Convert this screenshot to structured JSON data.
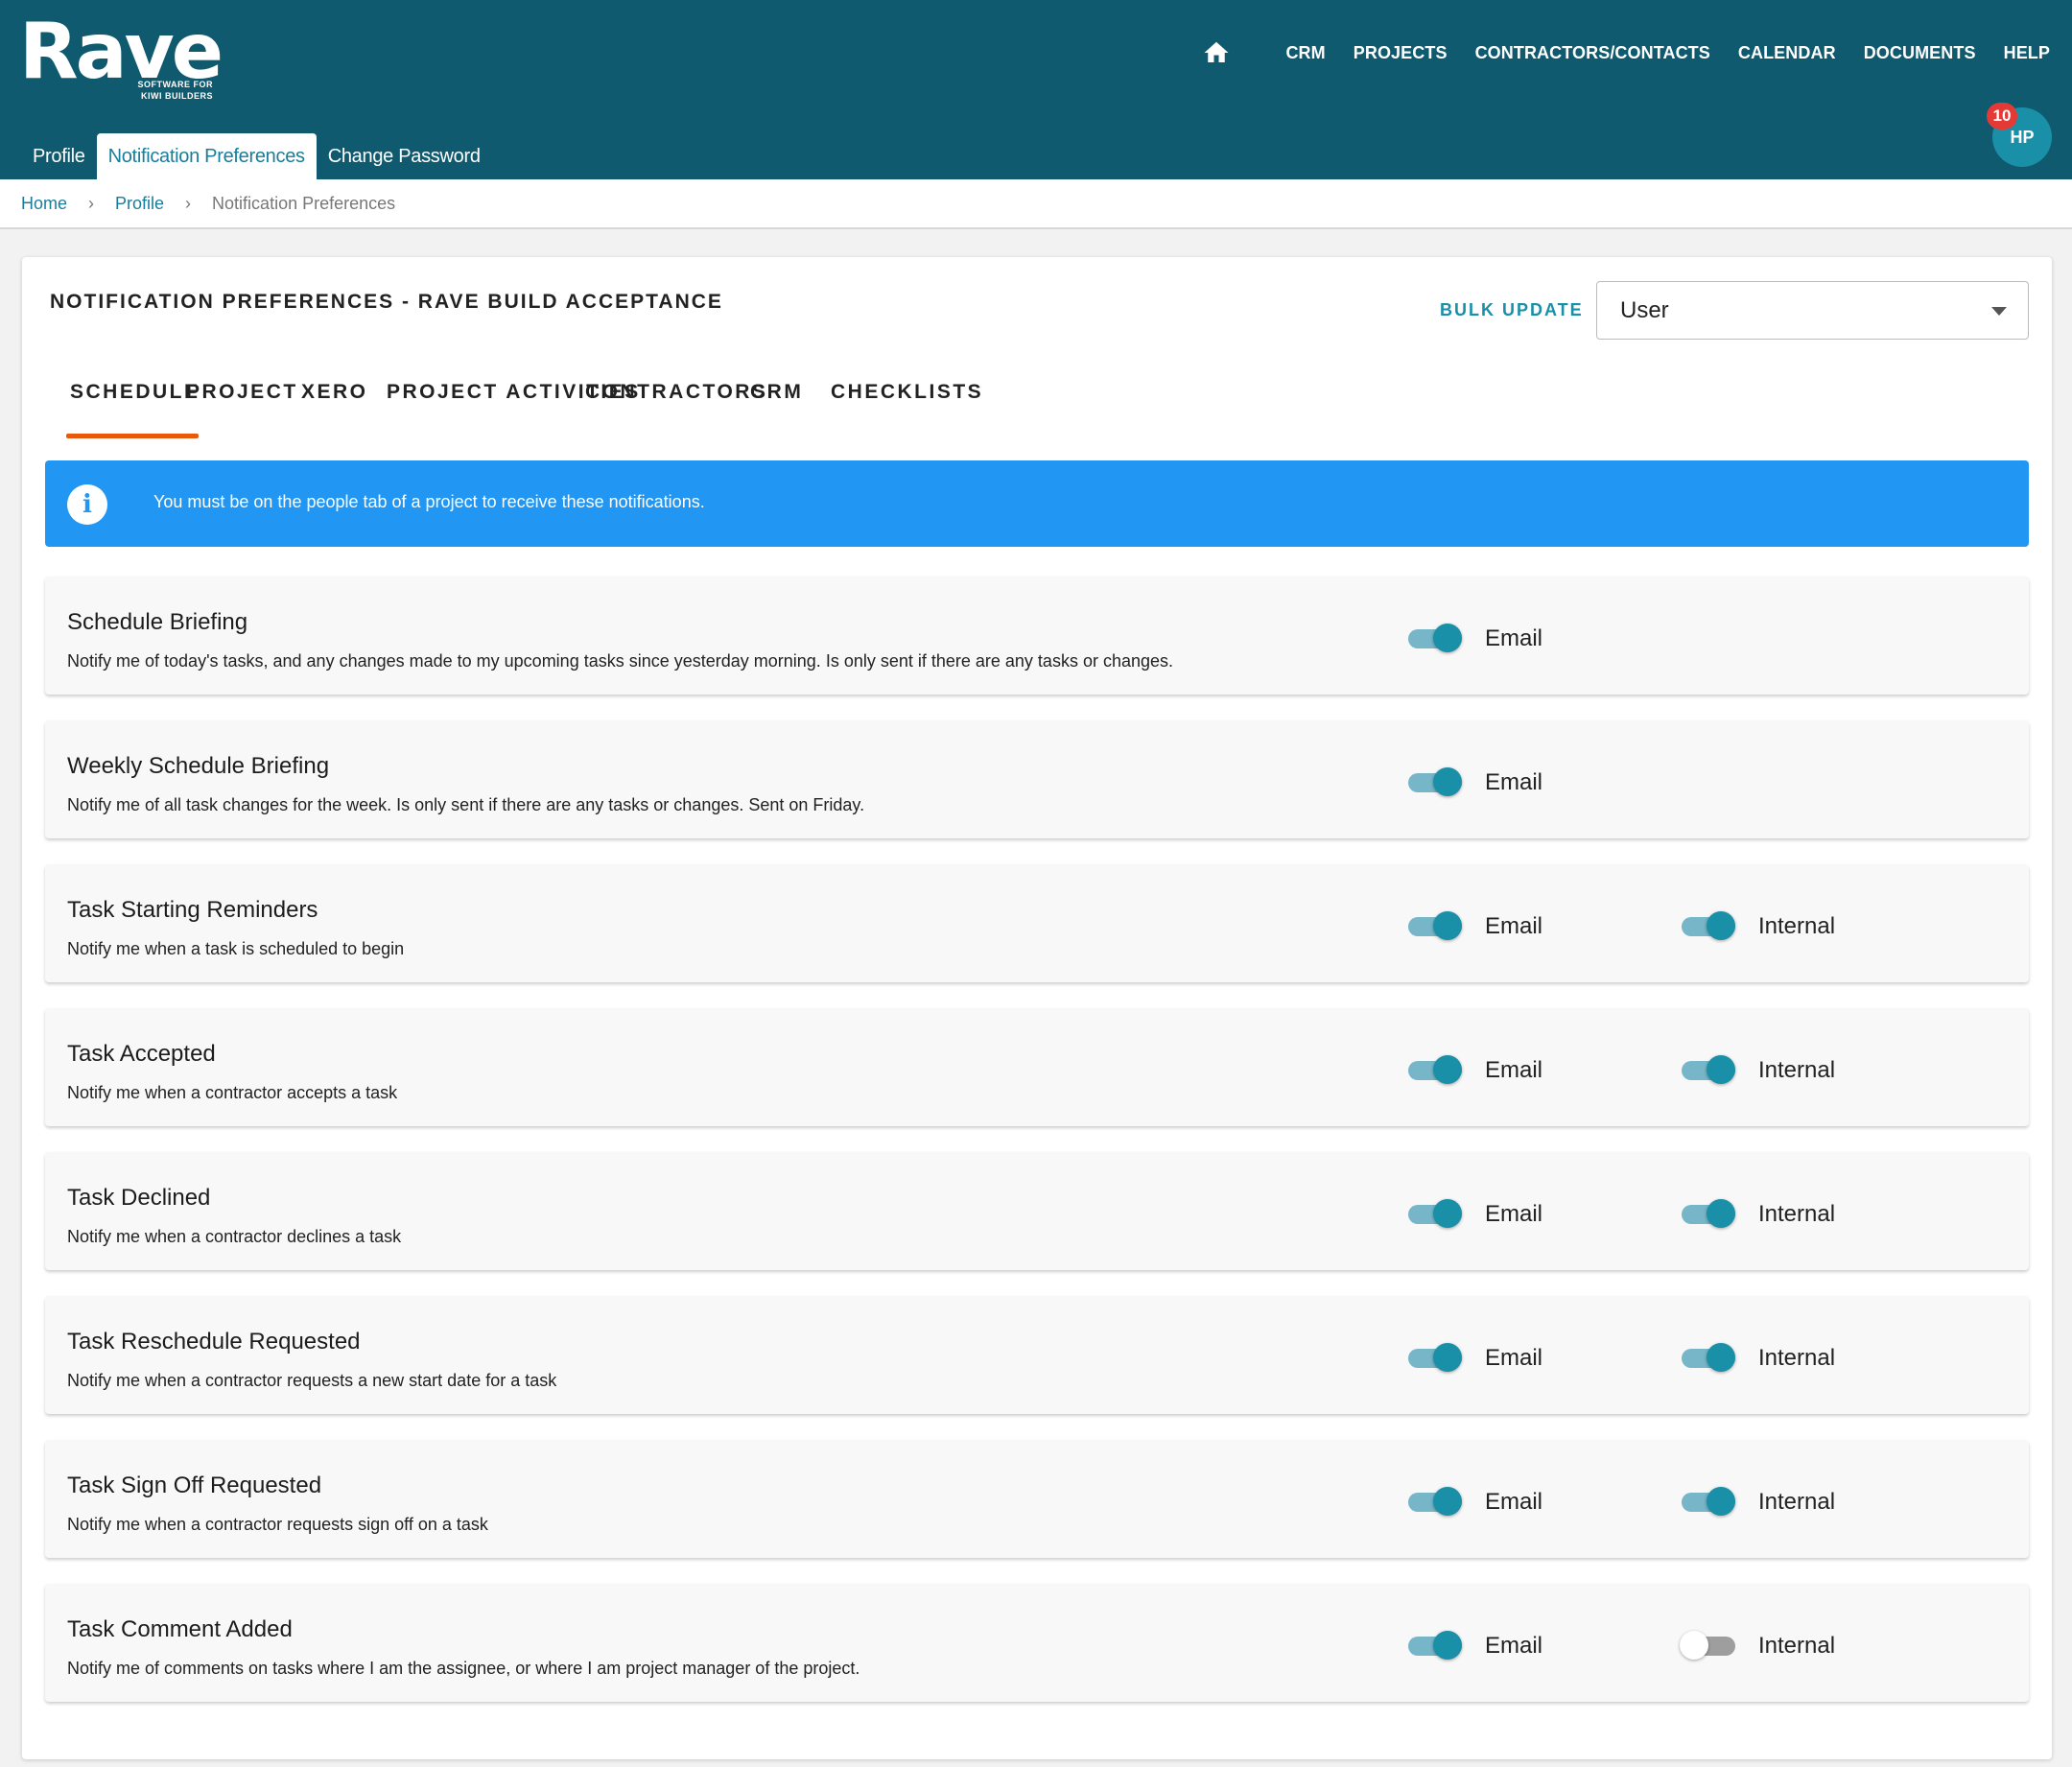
{
  "brand": {
    "name": "Rave",
    "tagline_1": "SOFTWARE FOR",
    "tagline_2": "KIWI BUILDERS"
  },
  "nav": {
    "home_icon": "home-icon",
    "items": [
      "CRM",
      "PROJECTS",
      "CONTRACTORS/CONTACTS",
      "CALENDAR",
      "DOCUMENTS",
      "HELP"
    ]
  },
  "subtabs": [
    "Profile",
    "Notification Preferences",
    "Change Password"
  ],
  "user": {
    "initials": "HP",
    "notifications": "10"
  },
  "breadcrumb": {
    "home": "Home",
    "profile": "Profile",
    "current": "Notification Preferences"
  },
  "page": {
    "title": "NOTIFICATION PREFERENCES - RAVE BUILD ACCEPTANCE",
    "bulk_update": "BULK UPDATE",
    "select_value": "User"
  },
  "tabs": [
    "SCHEDULE",
    "PROJECT",
    "XERO",
    "PROJECT ACTIVITIES",
    "CONTRACTORS",
    "CRM",
    "CHECKLISTS"
  ],
  "active_tab": "SCHEDULE",
  "alert": {
    "icon": "info-icon",
    "text": "You must be on the people tab of a project to receive these notifications."
  },
  "labels": {
    "email": "Email",
    "internal": "Internal"
  },
  "colors": {
    "header": "#0f5a6e",
    "accent": "#1a8fa8",
    "tab_underline": "#e8590c",
    "alert": "#2196f3"
  },
  "preferences": [
    {
      "title": "Schedule Briefing",
      "description": "Notify me of today's tasks, and any changes made to my upcoming tasks since yesterday morning. Is only sent if there are any tasks or changes.",
      "email": true
    },
    {
      "title": "Weekly Schedule Briefing",
      "description": "Notify me of all task changes for the week. Is only sent if there are any tasks or changes. Sent on Friday.",
      "email": true
    },
    {
      "title": "Task Starting Reminders",
      "description": "Notify me when a task is scheduled to begin",
      "email": true,
      "internal": true
    },
    {
      "title": "Task Accepted",
      "description": "Notify me when a contractor accepts a task",
      "email": true,
      "internal": true
    },
    {
      "title": "Task Declined",
      "description": "Notify me when a contractor declines a task",
      "email": true,
      "internal": true
    },
    {
      "title": "Task Reschedule Requested",
      "description": "Notify me when a contractor requests a new start date for a task",
      "email": true,
      "internal": true
    },
    {
      "title": "Task Sign Off Requested",
      "description": "Notify me when a contractor requests sign off on a task",
      "email": true,
      "internal": true
    },
    {
      "title": "Task Comment Added",
      "description": "Notify me of comments on tasks where I am the assignee, or where I am project manager of the project.",
      "email": true,
      "internal": false
    }
  ]
}
